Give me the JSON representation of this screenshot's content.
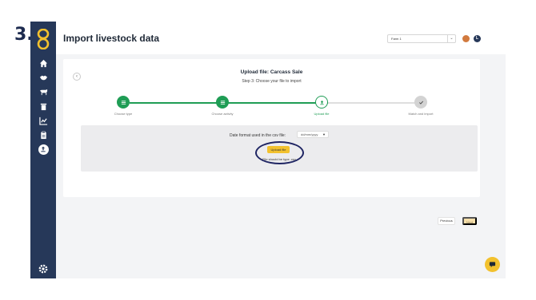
{
  "step_number": "3.",
  "page": {
    "title": "Import livestock data"
  },
  "header": {
    "farm_select": "Farm 1",
    "user_initial": "L"
  },
  "sidebar": {
    "items": [
      {
        "icon": "home-icon"
      },
      {
        "icon": "handshake-icon"
      },
      {
        "icon": "cow-icon"
      },
      {
        "icon": "trash-icon"
      },
      {
        "icon": "chart-icon"
      },
      {
        "icon": "clipboard-icon"
      },
      {
        "icon": "upload-icon",
        "active": true
      }
    ],
    "settings_icon": "gear-icon"
  },
  "wizard": {
    "title": "Upload file: Carcass Sale",
    "subtitle": "Step 3: Choose your file to import",
    "steps": [
      {
        "label": "Choose type",
        "state": "done"
      },
      {
        "label": "Choose activity",
        "state": "done"
      },
      {
        "label": "Upload file",
        "state": "current"
      },
      {
        "label": "Match and import",
        "state": "todo"
      }
    ],
    "date_format_label": "Date format used in the csv file:",
    "date_format_value": "dd/mm/yyyy",
    "upload_button": "Upload file",
    "file_note": "File should be type .csv",
    "previous_button": "Previous",
    "next_button": "Next"
  },
  "colors": {
    "accent_green": "#1f9d55",
    "sidebar": "#263859",
    "yellow": "#f2c12e",
    "annotation": "#1f2563"
  }
}
